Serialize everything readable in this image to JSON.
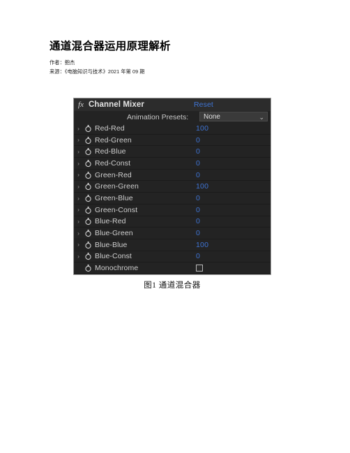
{
  "document": {
    "title": "通道混合器运用原理解析",
    "author_line": "作者：鲍杰",
    "source_line": "来源：《电脑知识与技术》2021 年第 09 期",
    "figure_caption": "图1  通道混合器"
  },
  "panel": {
    "fx_icon": "fx",
    "title": "Channel Mixer",
    "reset_label": "Reset",
    "presets_label": "Animation Presets:",
    "presets_value": "None",
    "chevron_down_icon": "⌄",
    "row_chevron_icon": "›",
    "rows": [
      {
        "label": "Red-Red",
        "value": "100",
        "type": "value",
        "expandable": true
      },
      {
        "label": "Red-Green",
        "value": "0",
        "type": "value",
        "expandable": true
      },
      {
        "label": "Red-Blue",
        "value": "0",
        "type": "value",
        "expandable": true
      },
      {
        "label": "Red-Const",
        "value": "0",
        "type": "value",
        "expandable": true
      },
      {
        "label": "Green-Red",
        "value": "0",
        "type": "value",
        "expandable": true
      },
      {
        "label": "Green-Green",
        "value": "100",
        "type": "value",
        "expandable": true
      },
      {
        "label": "Green-Blue",
        "value": "0",
        "type": "value",
        "expandable": true
      },
      {
        "label": "Green-Const",
        "value": "0",
        "type": "value",
        "expandable": true
      },
      {
        "label": "Blue-Red",
        "value": "0",
        "type": "value",
        "expandable": true
      },
      {
        "label": "Blue-Green",
        "value": "0",
        "type": "value",
        "expandable": true
      },
      {
        "label": "Blue-Blue",
        "value": "100",
        "type": "value",
        "expandable": true
      },
      {
        "label": "Blue-Const",
        "value": "0",
        "type": "value",
        "expandable": true
      },
      {
        "label": "Monochrome",
        "value": "",
        "type": "checkbox",
        "checked": false,
        "expandable": false
      }
    ]
  },
  "colors": {
    "panel_bg": "#232323",
    "header_bg": "#2c2c2c",
    "accent_blue": "#3f74d4",
    "label_text": "#cfcfcf",
    "page_bg": "#ffffff"
  }
}
